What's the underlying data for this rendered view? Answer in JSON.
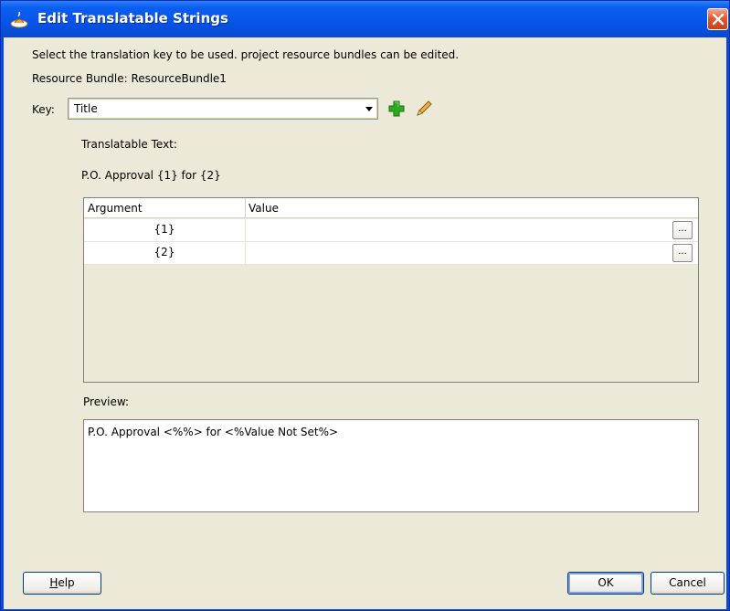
{
  "window": {
    "title": "Edit Translatable Strings"
  },
  "dialog": {
    "instruction": "Select the translation key to be used. project resource bundles can be edited.",
    "resource_bundle": "Resource Bundle: ResourceBundle1",
    "key_label": "Key:",
    "key_value": "Title",
    "translatable_text_label": "Translatable Text:",
    "translatable_text": "P.O. Approval {1} for {2}",
    "table": {
      "columns": [
        "Argument",
        "Value"
      ],
      "rows": [
        {
          "argument": "{1}",
          "value": "",
          "button": "..."
        },
        {
          "argument": "{2}",
          "value": "",
          "button": "..."
        }
      ]
    },
    "preview_label": "Preview:",
    "preview_text": "P.O. Approval <%%> for <%Value Not Set%>"
  },
  "buttons": {
    "help_prefix": "H",
    "help_rest": "elp",
    "ok": "OK",
    "cancel": "Cancel"
  },
  "icons": [
    "app-icon",
    "close-icon",
    "dropdown-arrow-icon",
    "add-icon",
    "edit-pencil-icon"
  ],
  "colors": {
    "titlebar": "#0a5ff0",
    "client_bg": "#ece9d8",
    "add_icon": "#2eaa1e",
    "close_button": "#e25a2e"
  }
}
